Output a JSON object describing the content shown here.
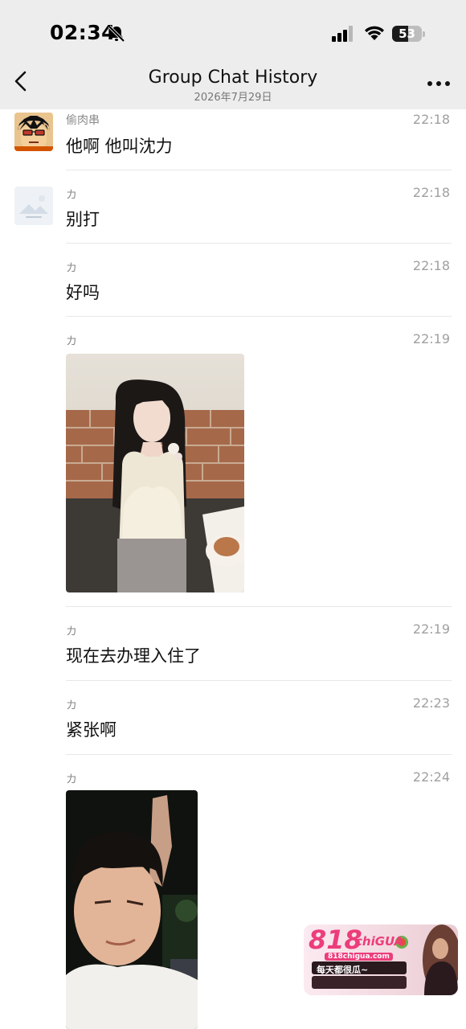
{
  "status_bar": {
    "time": "02:34",
    "battery": "53",
    "battery_level": 0.53
  },
  "nav": {
    "title": "Group Chat History",
    "subtitle": "2026年7月29日"
  },
  "messages": [
    {
      "sender": "偷肉串",
      "time": "22:18",
      "text": "他啊 他叫沈力",
      "avatar": "cartoon-avatar"
    },
    {
      "sender": "カ",
      "time": "22:18",
      "text": "别打",
      "avatar": "placeholder-avatar"
    },
    {
      "sender": "カ",
      "time": "22:18",
      "text": "好吗"
    },
    {
      "sender": "カ",
      "time": "22:19",
      "image": "photo-woman"
    },
    {
      "sender": "カ",
      "time": "22:19",
      "text": "现在去办理入住了"
    },
    {
      "sender": "カ",
      "time": "22:23",
      "text": "紧张啊"
    },
    {
      "sender": "カ",
      "time": "22:24",
      "image": "photo-man"
    }
  ],
  "watermark": {
    "brand": "818",
    "brand_suffix": "chiGUA",
    "url": "818chigua.com",
    "slogan": "每天都很瓜~"
  }
}
